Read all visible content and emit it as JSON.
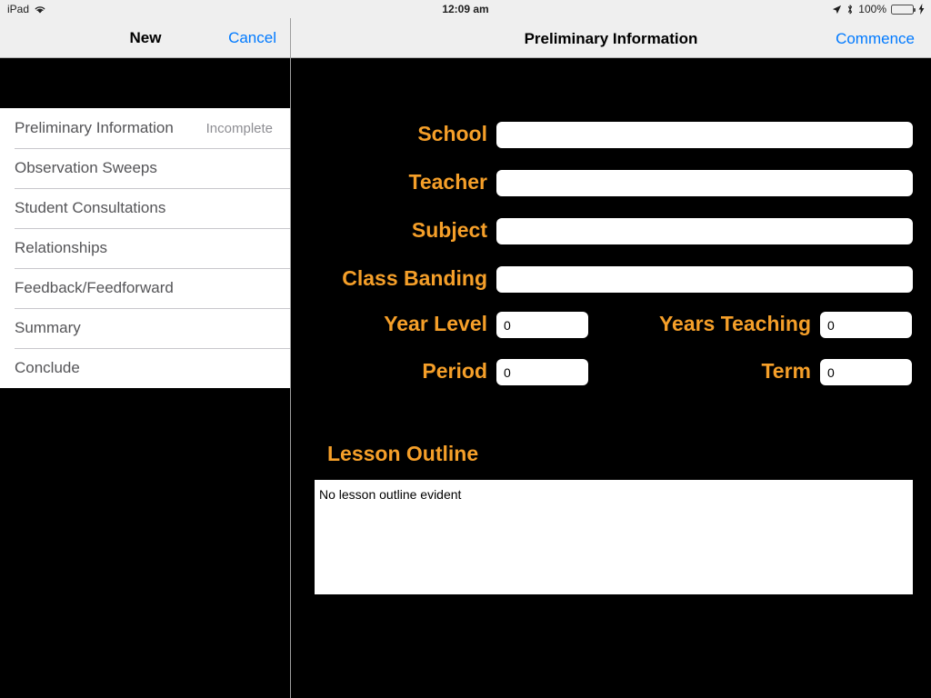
{
  "status_bar": {
    "device": "iPad",
    "wifi_icon": "wifi-icon",
    "time": "12:09 am",
    "location_icon": "location-arrow-icon",
    "bluetooth_icon": "bluetooth-icon",
    "battery_percent": "100%",
    "battery_level": 100,
    "charging_icon": "lightning-bolt-icon",
    "battery_color": "#4cd764"
  },
  "left_pane": {
    "title": "New",
    "cancel_label": "Cancel",
    "nav_items": [
      {
        "label": "Preliminary Information",
        "status": "Incomplete"
      },
      {
        "label": "Observation Sweeps",
        "status": ""
      },
      {
        "label": "Student Consultations",
        "status": ""
      },
      {
        "label": "Relationships",
        "status": ""
      },
      {
        "label": "Feedback/Feedforward",
        "status": ""
      },
      {
        "label": "Summary",
        "status": ""
      },
      {
        "label": "Conclude",
        "status": ""
      }
    ]
  },
  "right_pane": {
    "title": "Preliminary Information",
    "commence_label": "Commence",
    "accent_color": "#f59f29",
    "link_color": "#017aff",
    "fields": [
      {
        "label": "School",
        "value": "",
        "placeholder": ""
      },
      {
        "label": "Teacher",
        "value": "",
        "placeholder": ""
      },
      {
        "label": "Subject",
        "value": "",
        "placeholder": ""
      },
      {
        "label": "Class Banding",
        "value": "",
        "placeholder": ""
      },
      {
        "label": "Year Level",
        "value": "0",
        "placeholder": ""
      },
      {
        "label": "Years Teaching",
        "value": "0",
        "placeholder": ""
      },
      {
        "label": "Period",
        "value": "0",
        "placeholder": ""
      },
      {
        "label": "Term",
        "value": "0",
        "placeholder": ""
      }
    ],
    "lesson_outline": {
      "heading": "Lesson Outline",
      "value": "No lesson outline evident",
      "placeholder": ""
    }
  }
}
